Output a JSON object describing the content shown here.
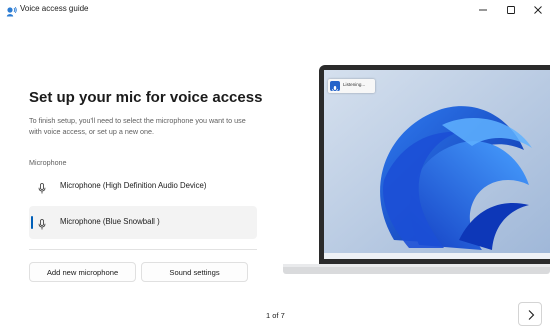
{
  "window": {
    "title": "Voice access guide",
    "icon": "voice-access-app-icon",
    "controls": [
      "minimize-icon",
      "maximize-icon",
      "close-icon"
    ]
  },
  "setup": {
    "heading": "Set up your mic for voice access",
    "description": "To finish setup, you'll need to select the microphone you want to use with voice access, or set up a new one.",
    "section_label": "Microphone",
    "microphones": [
      {
        "label": "Microphone (High Definition Audio Device)",
        "selected": false,
        "icon": "microphone-icon"
      },
      {
        "label": "Microphone (Blue Snowball )",
        "selected": true,
        "icon": "microphone-icon"
      }
    ],
    "buttons": {
      "add": "Add new microphone",
      "sound": "Sound settings"
    }
  },
  "illustration": {
    "listening_text": "Listening...",
    "listening_icon": "microphone-icon"
  },
  "footer": {
    "page": "1 of 7",
    "next_icon": "chevron-right-icon"
  },
  "colors": {
    "accent": "#005fb8",
    "wallpaper_blue": "#1f56d8",
    "selected_background": "#f3f3f3"
  }
}
